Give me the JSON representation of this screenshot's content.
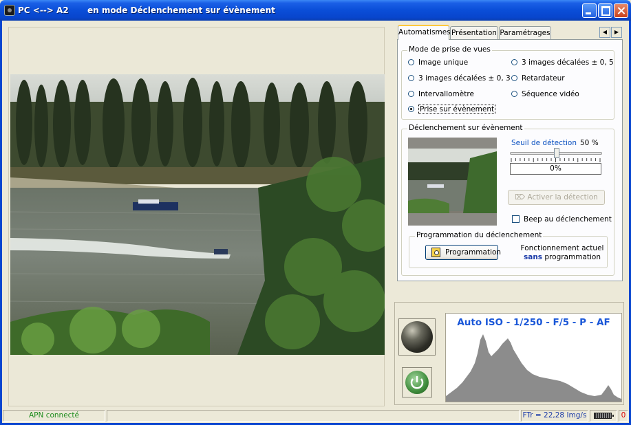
{
  "window": {
    "title_left": "PC <--> A2",
    "title_right": "en mode Déclenchement sur évènement"
  },
  "tabs": [
    {
      "label": "Automatismes",
      "active": true
    },
    {
      "label": "Présentation",
      "active": false
    },
    {
      "label": "Paramétrages",
      "active": false
    }
  ],
  "tab_scroll": {
    "left_icon": "arrow-left-icon",
    "right_icon": "arrow-right-icon"
  },
  "mode": {
    "title": "Mode de prise de vues",
    "options": [
      {
        "label": "Image unique",
        "selected": false
      },
      {
        "label": "3 images décalées ± 0, 5",
        "selected": false
      },
      {
        "label": "3 images décalées ± 0, 3",
        "selected": false
      },
      {
        "label": "Retardateur",
        "selected": false
      },
      {
        "label": "Intervallomètre",
        "selected": false
      },
      {
        "label": "Séquence vidéo",
        "selected": false
      },
      {
        "label": "Prise sur évènement",
        "selected": true
      }
    ]
  },
  "trigger": {
    "title": "Déclenchement sur évènement",
    "threshold_label": "Seuil de détection",
    "threshold_value": "50 %",
    "threshold_fraction": 0.5,
    "level_value": "0%",
    "activate_label": "Activer la détection",
    "beep_label": "Beep au déclenchement",
    "beep_checked": false
  },
  "programming": {
    "title": "Programmation du déclenchement",
    "button_label": "Programmation",
    "status_line1": "Fonctionnement actuel",
    "status_emph": "sans",
    "status_rest": "programmation"
  },
  "histogram": {
    "header": "Auto ISO - 1/250 - F/5 - P - AF",
    "fill_color": "#8c8c8c",
    "header_color": "#1a57d8"
  },
  "status": {
    "connection": "APN connecté",
    "message": "",
    "framerate": "FTr = 22,28 Img/s",
    "battery_icon": "battery-icon",
    "counter": "0"
  },
  "colors": {
    "titlebar": "#0a4ed8",
    "connection": "#1a8a1a",
    "link_blue": "#0a50c0"
  }
}
